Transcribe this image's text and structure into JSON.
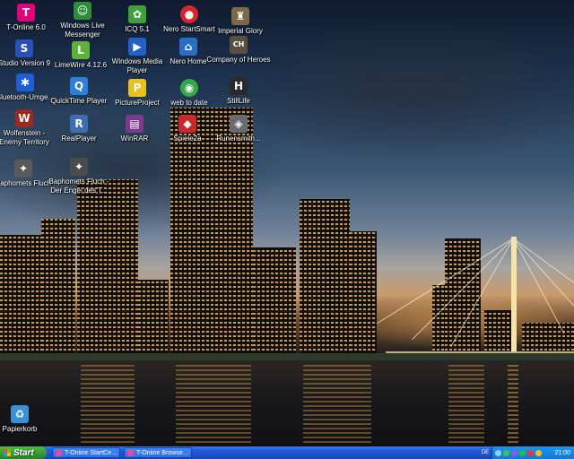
{
  "desktop": {
    "icons": [
      {
        "label": "T-Online 6.0",
        "icon": "t-online-icon",
        "color": "#e2007a",
        "glyph": "T"
      },
      {
        "label": "Studio Version 9",
        "icon": "pinnacle-studio-icon",
        "color": "#2a4fb8",
        "glyph": "S"
      },
      {
        "label": "Bluetooth-Umge...",
        "icon": "bluetooth-icon",
        "color": "#1e5ed6",
        "glyph": "✱"
      },
      {
        "label": "Wolfenstein - Enemy Territory",
        "icon": "wolfenstein-icon",
        "color": "#9a2a1e",
        "glyph": "W"
      },
      {
        "label": "Baphomets Fluch",
        "icon": "baphomets-fluch-icon",
        "color": "#5a5a5a",
        "glyph": "✦"
      },
      {
        "label": "Windows Live Messenger",
        "icon": "messenger-icon",
        "color": "#2f8d3a",
        "glyph": "☺"
      },
      {
        "label": "LimeWire 4.12.6",
        "icon": "limewire-icon",
        "color": "#5cb33a",
        "glyph": "L"
      },
      {
        "label": "QuickTime Player",
        "icon": "quicktime-icon",
        "color": "#2e7fd9",
        "glyph": "Q"
      },
      {
        "label": "RealPlayer",
        "icon": "realplayer-icon",
        "color": "#3b6fb0",
        "glyph": "R"
      },
      {
        "label": "Baphomets Fluch - Der Engel des T...",
        "icon": "baphomets-fluch-2-icon",
        "color": "#4b4b4b",
        "glyph": "✦"
      },
      {
        "label": "ICQ 5.1",
        "icon": "icq-icon",
        "color": "#3da03a",
        "glyph": "✿"
      },
      {
        "label": "Windows Media Player",
        "icon": "media-player-icon",
        "color": "#2262c4",
        "glyph": "▶"
      },
      {
        "label": "PictureProject",
        "icon": "pictureproject-icon",
        "color": "#e8c21a",
        "glyph": "P"
      },
      {
        "label": "WinRAR",
        "icon": "winrar-icon",
        "color": "#7a3b8f",
        "glyph": "▤"
      },
      {
        "label": "Nero StartSmart",
        "icon": "nero-startsmart-icon",
        "color": "#d8242a",
        "glyph": "●"
      },
      {
        "label": "Nero Home",
        "icon": "nero-home-icon",
        "color": "#2b6cc4",
        "glyph": "⌂"
      },
      {
        "label": "web to date",
        "icon": "web-to-date-icon",
        "color": "#35a84a",
        "glyph": "◉"
      },
      {
        "label": "Spiele2a",
        "icon": "spiele-icon",
        "color": "#c72a2a",
        "glyph": "◆"
      },
      {
        "label": "Imperial Glory",
        "icon": "imperial-glory-icon",
        "color": "#7a6a4a",
        "glyph": "♜"
      },
      {
        "label": "Company of Heroes",
        "icon": "company-of-heroes-icon",
        "color": "#5a5040",
        "glyph": "CH"
      },
      {
        "label": "StillLife",
        "icon": "stilllife-icon",
        "color": "#2a2a2a",
        "glyph": "H"
      },
      {
        "label": "Runensmith...",
        "icon": "runensmith-icon",
        "color": "#6a6a70",
        "glyph": "◈"
      },
      {
        "label": "Papierkorb",
        "icon": "recycle-bin-icon",
        "color": "#3a8fd6",
        "glyph": "♻"
      }
    ]
  },
  "taskbar": {
    "start_label": "Start",
    "tasks": [
      {
        "label": "T-Online StartCen..."
      },
      {
        "label": "T-Online Browser ..."
      }
    ],
    "language": "DE",
    "tray_icons": [
      "#8fd0ff",
      "#3fbf5f",
      "#9a58d8",
      "#2fb84a",
      "#e23a3a",
      "#f0c020"
    ],
    "clock": "21:00"
  },
  "colors": {
    "taskbar_blue": "#2459d9",
    "start_green": "#379a33",
    "tray_blue": "#1577d4"
  }
}
